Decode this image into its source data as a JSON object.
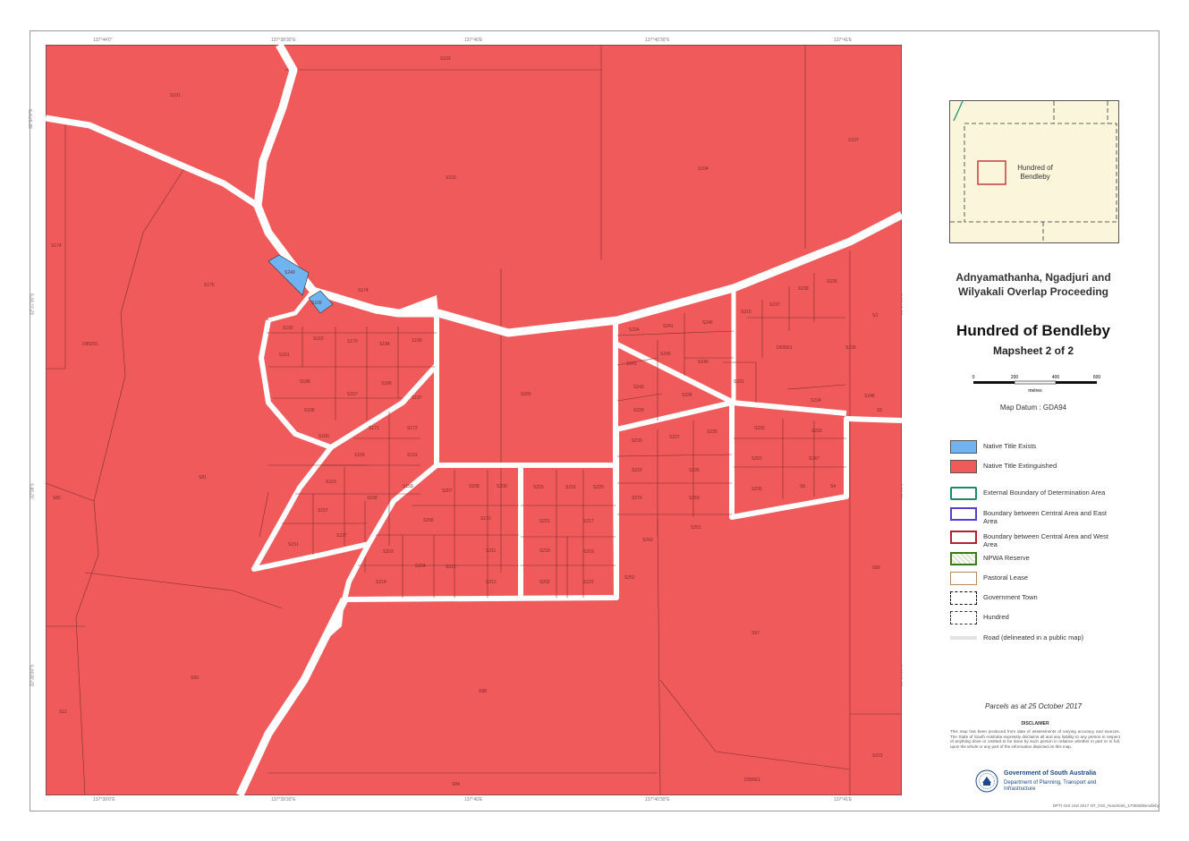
{
  "map": {
    "tick_top": [
      "137°44'0\"",
      "137°38'30\"E",
      "137°40'E",
      "137°40'30\"E",
      "137°41'E"
    ],
    "tick_bottom": [
      "137°39'0\"E",
      "137°39'30\"E",
      "137°40'E",
      "137°40'30\"E",
      "137°41'E"
    ],
    "tick_left": [
      "32°37'0\"S",
      "32°37'30\"S",
      "32°38'S",
      "32°38'30\"S"
    ],
    "tick_right": [
      "32°37'0\"S",
      "32°37'30\"S",
      "32°38'S",
      "32°38'30\"S"
    ],
    "parcels": {
      "p1": "S101",
      "p2": "S102",
      "p3": "S103",
      "p4": "S104",
      "p5": "S107",
      "p6": "S174",
      "p7": "S175",
      "p8": "S174",
      "p9": "S192",
      "p10": "S162",
      "p11": "S170",
      "p12": "S184",
      "p13": "S190",
      "p14": "S161",
      "p15": "S188",
      "p16": "S167",
      "p17": "S186",
      "p18": "S197",
      "p19": "S196",
      "p20": "S180",
      "p21": "S171",
      "p22": "S172",
      "p23": "S155",
      "p24": "S191",
      "p25": "S153",
      "p26": "S158",
      "p27": "S159",
      "p28": "S157",
      "p29": "S151",
      "p30": "S227",
      "p31": "S207",
      "p32": "S208",
      "p33": "S209",
      "p34": "S206",
      "p35": "S210",
      "p36": "S203",
      "p37": "S204",
      "p38": "S211",
      "p39": "S212",
      "p40": "S213",
      "p41": "S214",
      "p42": "S215",
      "p43": "S216",
      "p44": "S220",
      "p45": "S221",
      "p46": "S217",
      "p47": "S218",
      "p48": "S219",
      "p49": "S202",
      "p50": "S222",
      "p51": "S200",
      "p52": "S224",
      "p53": "S241",
      "p54": "S246",
      "p55": "S245",
      "p56": "S240",
      "p57": "S241",
      "p58": "S242",
      "p59": "S228",
      "p60": "S229",
      "p61": "S230",
      "p62": "S227",
      "p63": "S225",
      "p64": "S223",
      "p65": "S226",
      "p66": "S270",
      "p67": "S250",
      "p68": "S243",
      "p69": "S251",
      "p70": "S252",
      "p71": "D59961",
      "p72": "S210",
      "p73": "S237",
      "p74": "S238",
      "p75": "S236",
      "p76": "S231",
      "p77": "S234",
      "p78": "S232",
      "p79": "S233",
      "p80": "S201",
      "p81": "S247",
      "p82": "S235",
      "p83": "S6",
      "p84": "S4",
      "p85": "S3",
      "p86": "S5",
      "p87": "S56",
      "p88": "S97",
      "p89": "S222",
      "p90": "S88",
      "p91": "S93",
      "p92": "S84",
      "p93": "D59961",
      "p94": "D89291",
      "p95": "S81",
      "p96": "S82",
      "p97": "S11",
      "p98": "S249",
      "p99": "S109",
      "p100": "S248",
      "p101": "S239"
    }
  },
  "inset": {
    "label": "Hundred of Bendleby"
  },
  "title": {
    "proceeding": "Adnyamathanha, Ngadjuri and Wilyakali Overlap Proceeding",
    "main": "Hundred of Bendleby",
    "sub": "Mapsheet 2 of 2"
  },
  "scale": {
    "ticks": [
      "0",
      "200",
      "400",
      "600"
    ],
    "unit": "metres"
  },
  "datum": "Map Datum : GDA94",
  "legend": [
    {
      "label": "Native Title Exists",
      "color": "#6fb3f0"
    },
    {
      "label": "Native Title Extinguished",
      "color": "#f15a5a"
    },
    {
      "label": "External Boundary of Determination Area",
      "color": "#1a8a6a"
    },
    {
      "label": "Boundary between Central Area and East Area",
      "color": "#5a3bd6"
    },
    {
      "label": "Boundary between Central Area and West Area",
      "color": "#b4232a"
    },
    {
      "label": "NPWA Reserve",
      "color": "#3a7a1a"
    },
    {
      "label": "Pastoral Lease",
      "color": "#b08a5a"
    },
    {
      "label": "Government Town",
      "color": "#111111"
    },
    {
      "label": "Hundred",
      "color": "#333333"
    },
    {
      "label": "Road (delineated in a public map)",
      "color": "#d9d9d9"
    }
  ],
  "parcels_date": "Parcels as at 25 October 2017",
  "disclaimer": {
    "title": "DISCLAIMER",
    "text": "This map has been produced from data of assessments of varying accuracy and sources. The State of South Australia expressly disclaims all and any liability to any person in respect of anything done or omitted to be done by such person in reliance whether in part or in full, upon the whole or any part of the information depicted on this map."
  },
  "government": {
    "name": "Government of South Australia",
    "department": "Department of Planning, Transport and Infrastructure"
  },
  "doc_ref": "DPTI GIS Unit 2017 NT_GIS_Hundreds_170809/Bendleby"
}
